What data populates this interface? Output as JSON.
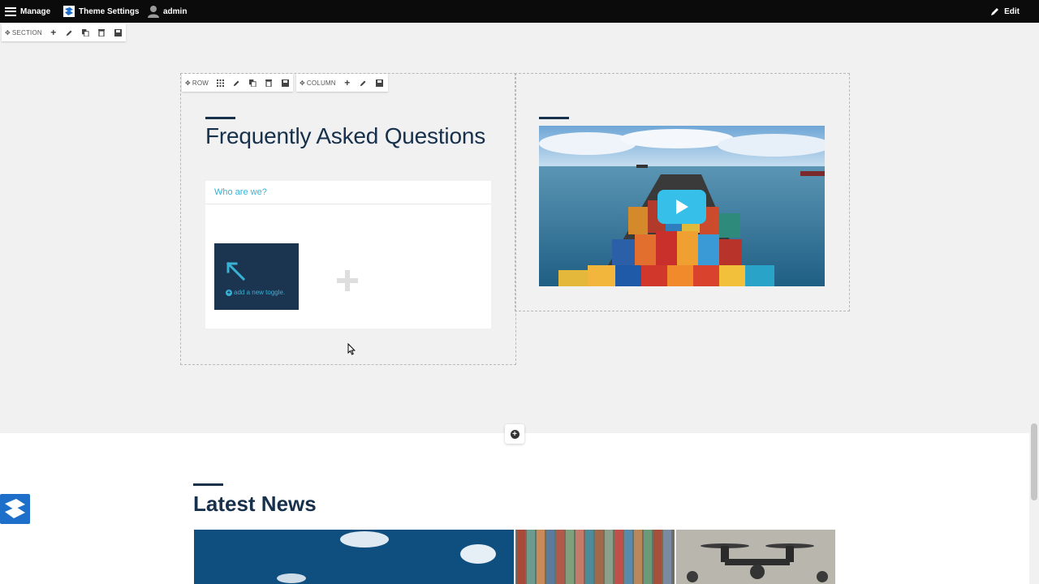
{
  "adminbar": {
    "manage_label": "Manage",
    "theme_settings_label": "Theme Settings",
    "user_label": "admin",
    "edit_label": "Edit"
  },
  "toolbars": {
    "section_label": "SECTION",
    "row_label": "ROW",
    "column_label": "COLUMN"
  },
  "faq": {
    "title": "Frequently Asked Questions",
    "question": "Who are we?",
    "add_toggle_label": "add a new toggle."
  },
  "news": {
    "title": "Latest News"
  },
  "icons": [
    "hamburger-icon",
    "theme-logo-icon",
    "user-icon",
    "pencil-icon",
    "move-icon",
    "plus-icon",
    "grid-icon",
    "copy-icon",
    "trash-icon",
    "save-icon",
    "arrow-up-left-icon",
    "play-icon",
    "add-section-icon",
    "cursor-icon"
  ],
  "colors": {
    "accent_dark": "#17304b",
    "accent_cyan": "#37b2d6",
    "play_button": "#36bfe8",
    "admin_bar": "#0b0b0b"
  }
}
